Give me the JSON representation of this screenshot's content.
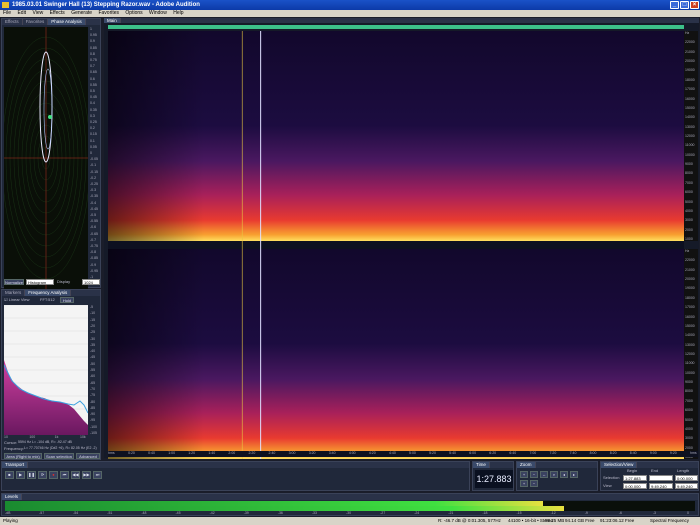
{
  "window": {
    "title": "1985.03.01 Swinger Hall (13) Stepping Razor.wav - Adobe Audition"
  },
  "menu": [
    "File",
    "Edit",
    "View",
    "Effects",
    "Generate",
    "Favorites",
    "Options",
    "Window",
    "Help"
  ],
  "left_top_tabs": [
    "Effects",
    "Favorites",
    "Phase Analysis"
  ],
  "phase": {
    "scale_right": [
      "1",
      "0.95",
      "0.9",
      "0.85",
      "0.8",
      "0.75",
      "0.7",
      "0.65",
      "0.6",
      "0.55",
      "0.5",
      "0.45",
      "0.4",
      "0.35",
      "0.3",
      "0.25",
      "0.2",
      "0.15",
      "0.1",
      "0.05",
      "0",
      "-0.05",
      "-0.1",
      "-0.15",
      "-0.2",
      "-0.25",
      "-0.3",
      "-0.35",
      "-0.4",
      "-0.45",
      "-0.5",
      "-0.55",
      "-0.6",
      "-0.65",
      "-0.7",
      "-0.75",
      "-0.8",
      "-0.85",
      "-0.9",
      "-0.95",
      "-1"
    ],
    "bottom_left": "L",
    "bottom_right": "R",
    "controls": {
      "normalize": "Normalize",
      "mode": "Histogram (Log)",
      "display": "Display",
      "display_value": "1024"
    }
  },
  "freq_tabs": [
    "Markers",
    "Frequency Analysis"
  ],
  "freq": {
    "linear_view": "Linear View",
    "fft_label": "FFT:",
    "fft_value": "512",
    "hold": "Hold",
    "x_ticks": [
      "10",
      "100",
      "1k",
      "10k"
    ],
    "y_ticks": [
      "-5",
      "-10",
      "-15",
      "-20",
      "-25",
      "-30",
      "-35",
      "-40",
      "-45",
      "-50",
      "-55",
      "-60",
      "-65",
      "-70",
      "-75",
      "-80",
      "-85",
      "-90",
      "-95",
      "-100",
      "-105"
    ],
    "cursor": "Cursor:",
    "cursor_value": "5594 Hz  L= -104 dB, R= -92.47 dB",
    "frequency": "Frequency:",
    "frequency_value": "L= 77.70746 Hz (D#2 +6), R= 82.05 Hz (E2 -2)",
    "buttons": [
      "Area (Right to mix)",
      "Scan selection",
      "Advanced"
    ]
  },
  "main": {
    "tab": "Main",
    "freq_scale_top": [
      "Hz",
      "22000",
      "21000",
      "20000",
      "19000",
      "18000",
      "17000",
      "16000",
      "15000",
      "14000",
      "13000",
      "12000",
      "11000",
      "10000",
      "9000",
      "8000",
      "7000",
      "6000",
      "5000",
      "4000",
      "3000",
      "2000",
      "1000"
    ],
    "freq_scale_bottom": [
      "Hz",
      "22000",
      "21000",
      "20000",
      "19000",
      "18000",
      "17000",
      "16000",
      "15000",
      "14000",
      "13000",
      "12000",
      "11000",
      "10000",
      "9000",
      "8000",
      "7000",
      "6000",
      "5000",
      "4000",
      "3000",
      "2000",
      "1000"
    ],
    "time_ticks": [
      "hms",
      "0:20",
      "0:40",
      "1:00",
      "1:20",
      "1:40",
      "2:00",
      "2:20",
      "2:40",
      "3:00",
      "3:20",
      "3:40",
      "4:00",
      "4:20",
      "4:40",
      "5:00",
      "5:20",
      "5:40",
      "6:00",
      "6:20",
      "6:40",
      "7:00",
      "7:20",
      "7:40",
      "8:00",
      "8:20",
      "8:40",
      "9:00",
      "9:20",
      "hms"
    ],
    "playhead_fraction": 0.265,
    "marker_fraction": 0.233
  },
  "transport": {
    "title": "Transport",
    "buttons": [
      "stop",
      "play",
      "pause",
      "play-loop",
      "record",
      "go-start",
      "rewind",
      "forward",
      "go-end"
    ]
  },
  "time": {
    "title": "Time",
    "value": "1:27.883"
  },
  "zoom": {
    "title": "Zoom"
  },
  "selection": {
    "title": "Selection/View",
    "headers": [
      "Begin",
      "End",
      "Length"
    ],
    "rows": [
      {
        "label": "Selection",
        "begin": "1:27.883",
        "end": "",
        "length": "0:00.000"
      },
      {
        "label": "View",
        "begin": "0:00.000",
        "end": "9:49.240",
        "length": "9:49.240"
      }
    ]
  },
  "levels": {
    "title": "Levels",
    "scale": [
      "-dB",
      "-57",
      "-54",
      "-51",
      "-48",
      "-45",
      "-42",
      "-39",
      "-36",
      "-33",
      "-30",
      "-27",
      "-24",
      "-21",
      "-18",
      "-15",
      "-12",
      "-9",
      "-6",
      "-3",
      "0"
    ],
    "left_fraction": 0.78,
    "right_fraction": 0.81
  },
  "status": {
    "state": "Playing",
    "level": "R: -46.7 dB @ 0:01.305, 577Hz",
    "format": "44100 • 16-bit • Stereo",
    "size": "99.25 MB",
    "free": "94.14 GB Free",
    "time_free": "91:23:06.12 Free",
    "view": "Spectral Frequency"
  },
  "colors": {
    "accent": "#3cc08a",
    "spectro_low": "#1a0f3a",
    "spectro_high": "#ffdc3c"
  }
}
